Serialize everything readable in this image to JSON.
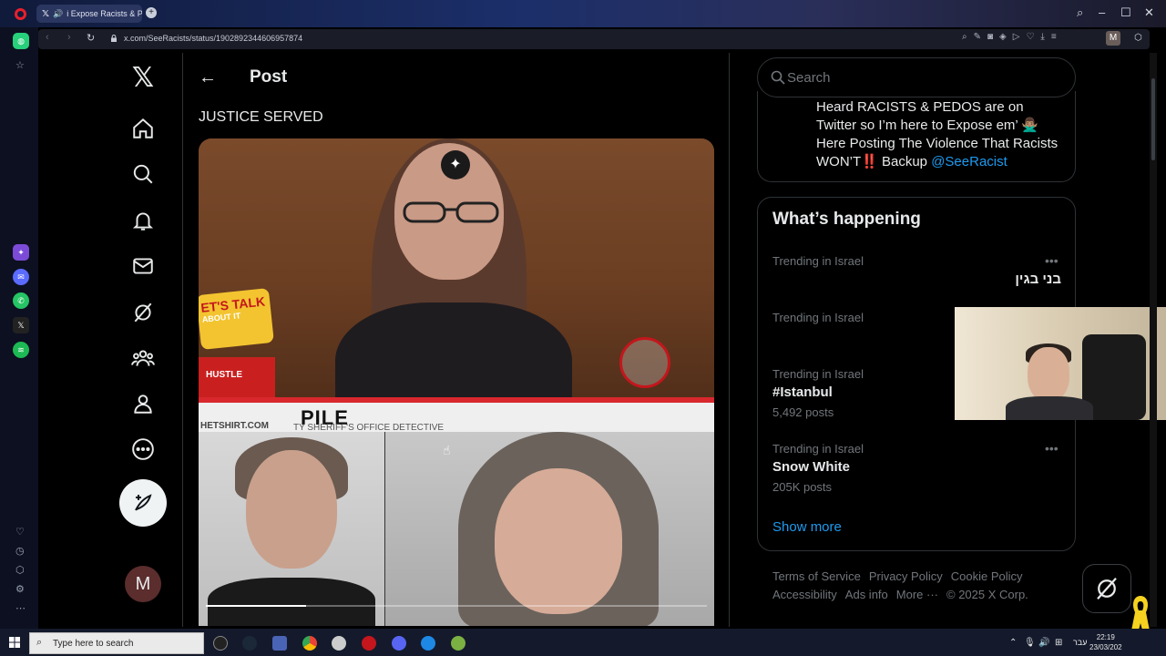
{
  "browser": {
    "tab_title": "i Expose Racists & Pe",
    "url": "x.com/SeeRacists/status/1902892344606957874",
    "profile_initial": "M"
  },
  "nav": {
    "items": [
      "home",
      "explore",
      "notifications",
      "messages",
      "grok",
      "communities",
      "profile",
      "more"
    ],
    "post_button": "post",
    "avatar_initial": "M"
  },
  "header": {
    "title": "Post"
  },
  "post": {
    "text": "JUSTICE SERVED",
    "media": {
      "lower_third": "PILE",
      "lower_third_sub": "TY SHERIFF'S OFFICE DETECTIVE",
      "lets_talk": "ET'S TALK",
      "lets_talk_sub": "ABOUT IT",
      "hustle": "HUSTLE",
      "hustle_sub": "HETSHIRT.COM",
      "video_progress": 0.2
    }
  },
  "search": {
    "placeholder": "Search"
  },
  "bio": {
    "text": "Heard RACISTS & PEDOS are on Twitter so I’m here to Expose em’ 🙅🏽‍♂️ Here Posting The Violence That Racists WON’T‼️ Backup ",
    "mention": "@SeeRacist"
  },
  "trends": {
    "title": "What’s happening",
    "items": [
      {
        "meta": "Trending in Israel",
        "name": "בני בגין",
        "posts": ""
      },
      {
        "meta": "Trending in Israel",
        "name": "",
        "posts": ""
      },
      {
        "meta": "Trending in Israel",
        "name": "#Istanbul",
        "posts": "5,492 posts"
      },
      {
        "meta": "Trending in Israel",
        "name": "Snow White",
        "posts": "205K posts"
      }
    ],
    "show_more": "Show more"
  },
  "footer": {
    "links": [
      "Terms of Service",
      "Privacy Policy",
      "Cookie Policy",
      "Accessibility",
      "Ads info",
      "More ···",
      "© 2025 X Corp."
    ]
  },
  "taskbar": {
    "search_placeholder": "Type here to search",
    "time": "22:19",
    "date": "23/03/202",
    "lang": "עבר"
  },
  "colors": {
    "accent": "#1d9bf0",
    "background": "#000000",
    "border": "#2f3336",
    "muted": "#71767b"
  }
}
